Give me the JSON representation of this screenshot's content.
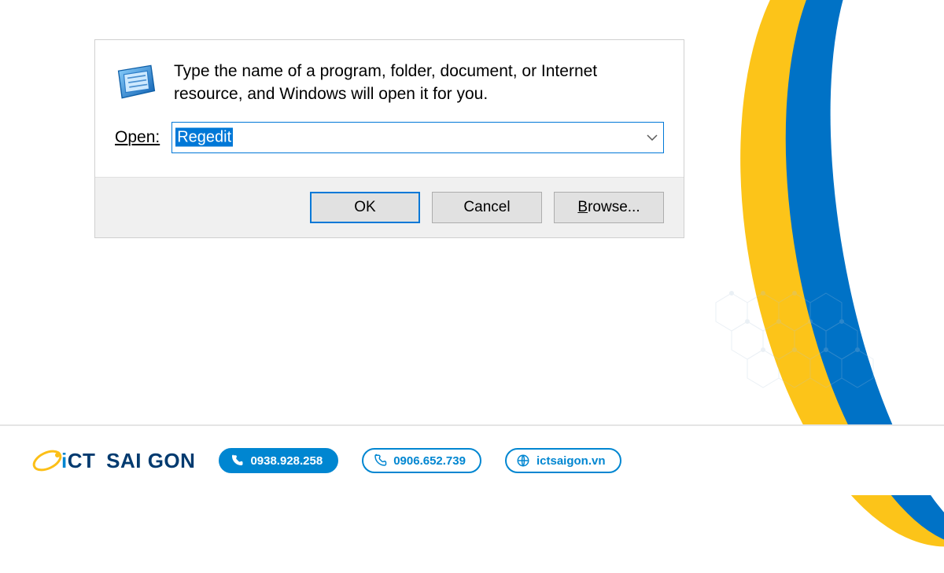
{
  "dialog": {
    "description": "Type the name of a program, folder, document, or Internet resource, and Windows will open it for you.",
    "open_label": "Open:",
    "input_value": "Regedit",
    "buttons": {
      "ok": "OK",
      "cancel": "Cancel",
      "browse": "Browse..."
    }
  },
  "footer": {
    "brand": "SAI GON",
    "brand_prefix": "iCT",
    "phone1": "0938.928.258",
    "phone2": "0906.652.739",
    "website": "ictsaigon.vn"
  }
}
